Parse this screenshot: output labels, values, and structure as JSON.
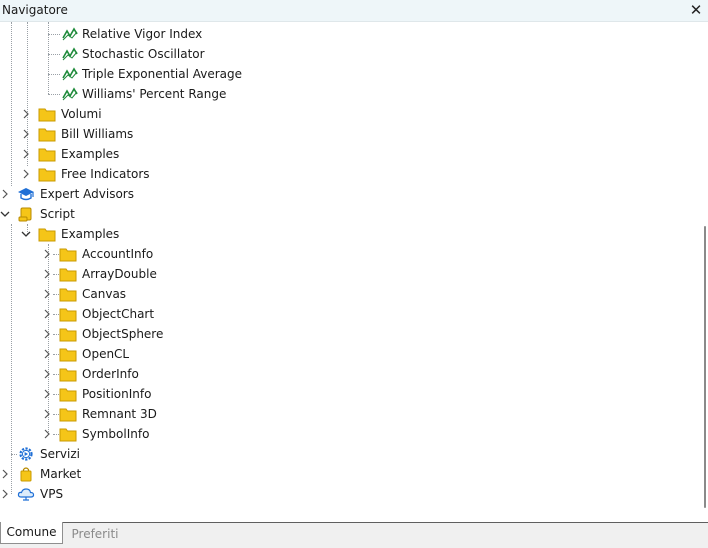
{
  "window": {
    "title": "Navigatore",
    "close_glyph": "✕"
  },
  "tree": {
    "ind_relative_vigor": "Relative Vigor Index",
    "ind_stochastic": "Stochastic Oscillator",
    "ind_triple_ema": "Triple Exponential Average",
    "ind_williams_pr": "Williams' Percent Range",
    "folder_volumi": "Volumi",
    "folder_bill_williams": "Bill Williams",
    "folder_examples_ind": "Examples",
    "folder_free_indicators": "Free Indicators",
    "expert_advisors": "Expert Advisors",
    "script": "Script",
    "script_examples": "Examples",
    "script_children": {
      "accountinfo": "AccountInfo",
      "arraydouble": "ArrayDouble",
      "canvas": "Canvas",
      "objectchart": "ObjectChart",
      "objectsphere": "ObjectSphere",
      "opencl": "OpenCL",
      "orderinfo": "OrderInfo",
      "positioninfo": "PositionInfo",
      "remnant3d": "Remnant 3D",
      "symbolinfo": "SymbolInfo"
    },
    "servizi": "Servizi",
    "market": "Market",
    "vps": "VPS"
  },
  "tabs": {
    "comune": "Comune",
    "preferiti": "Preferiti"
  },
  "colors": {
    "folder": "#f5c518",
    "indicator": "#1e8a3a",
    "accent_blue": "#1f6fd6"
  }
}
